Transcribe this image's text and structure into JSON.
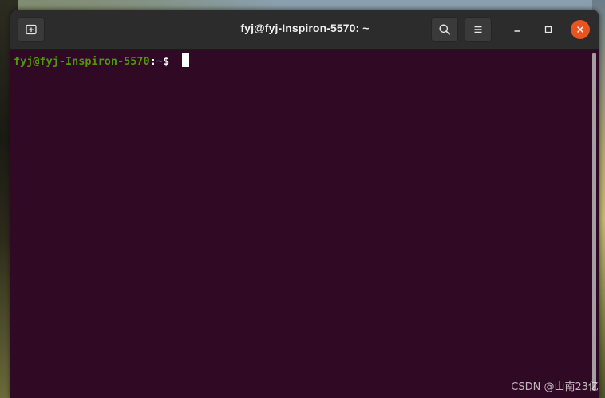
{
  "window": {
    "title": "fyj@fyj-Inspiron-5570: ~"
  },
  "titlebar": {
    "new_tab_icon": "new-tab-icon",
    "search_icon": "search-icon",
    "menu_icon": "hamburger-menu-icon",
    "minimize_icon": "minimize-icon",
    "maximize_icon": "maximize-icon",
    "close_icon": "close-icon"
  },
  "terminal": {
    "prompt_user": "fyj@fyj-Inspiron-5570",
    "prompt_sep": ":",
    "prompt_path": "~",
    "prompt_symbol": "$ "
  },
  "watermark": "CSDN @山南23亿",
  "colors": {
    "terminal_bg": "#300a24",
    "titlebar_bg": "#2c2c2c",
    "prompt_user": "#4e9a06",
    "prompt_path": "#3465a4",
    "close_button": "#e95420"
  }
}
